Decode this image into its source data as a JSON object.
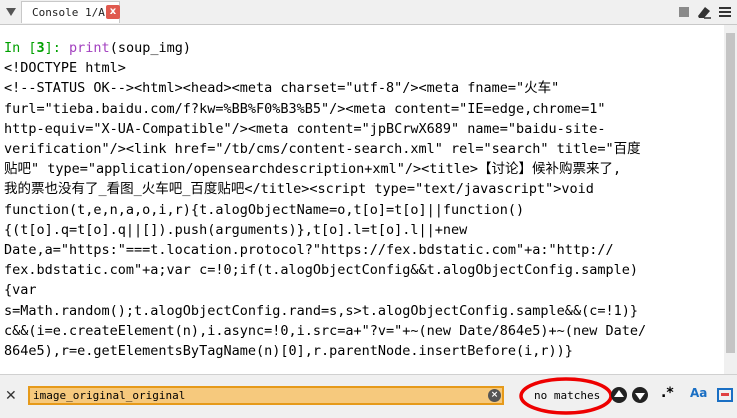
{
  "tab": {
    "label": "Console 1/A",
    "close": "x"
  },
  "console": {
    "prompt": "In [",
    "prompt_num": "3",
    "prompt_end": "]: ",
    "print_fn": "print",
    "print_args": "(soup_img)",
    "output": "<!DOCTYPE html>\n<!--STATUS OK--><html><head><meta charset=\"utf-8\"/><meta fname=\"火车\"\nfurl=\"tieba.baidu.com/f?kw=%BB%F0%B3%B5\"/><meta content=\"IE=edge,chrome=1\"\nhttp-equiv=\"X-UA-Compatible\"/><meta content=\"jpBCrwX689\" name=\"baidu-site-\nverification\"/><link href=\"/tb/cms/content-search.xml\" rel=\"search\" title=\"百度\n贴吧\" type=\"application/opensearchdescription+xml\"/><title>【讨论】候补购票来了,\n我的票也没有了_看图_火车吧_百度贴吧</title><script type=\"text/javascript\">void\nfunction(t,e,n,a,o,i,r){t.alogObjectName=o,t[o]=t[o]||function()\n{(t[o].q=t[o].q||[]).push(arguments)},t[o].l=t[o].l||+new\nDate,a=\"https:\"===t.location.protocol?\"https://fex.bdstatic.com\"+a:\"http://\nfex.bdstatic.com\"+a;var c=!0;if(t.alogObjectConfig&&t.alogObjectConfig.sample)\n{var\ns=Math.random();t.alogObjectConfig.rand=s,s>t.alogObjectConfig.sample&&(c=!1)}\nc&&(i=e.createElement(n),i.async=!0,i.src=a+\"?v=\"+~(new Date/864e5)+~(new Date/\n864e5),r=e.getElementsByTagName(n)[0],r.parentNode.insertBefore(i,r))}"
  },
  "find": {
    "close": "✕",
    "value": "image_original_original",
    "clear": "×",
    "status": "no matches",
    "regex": ".*",
    "case": "Aa"
  }
}
